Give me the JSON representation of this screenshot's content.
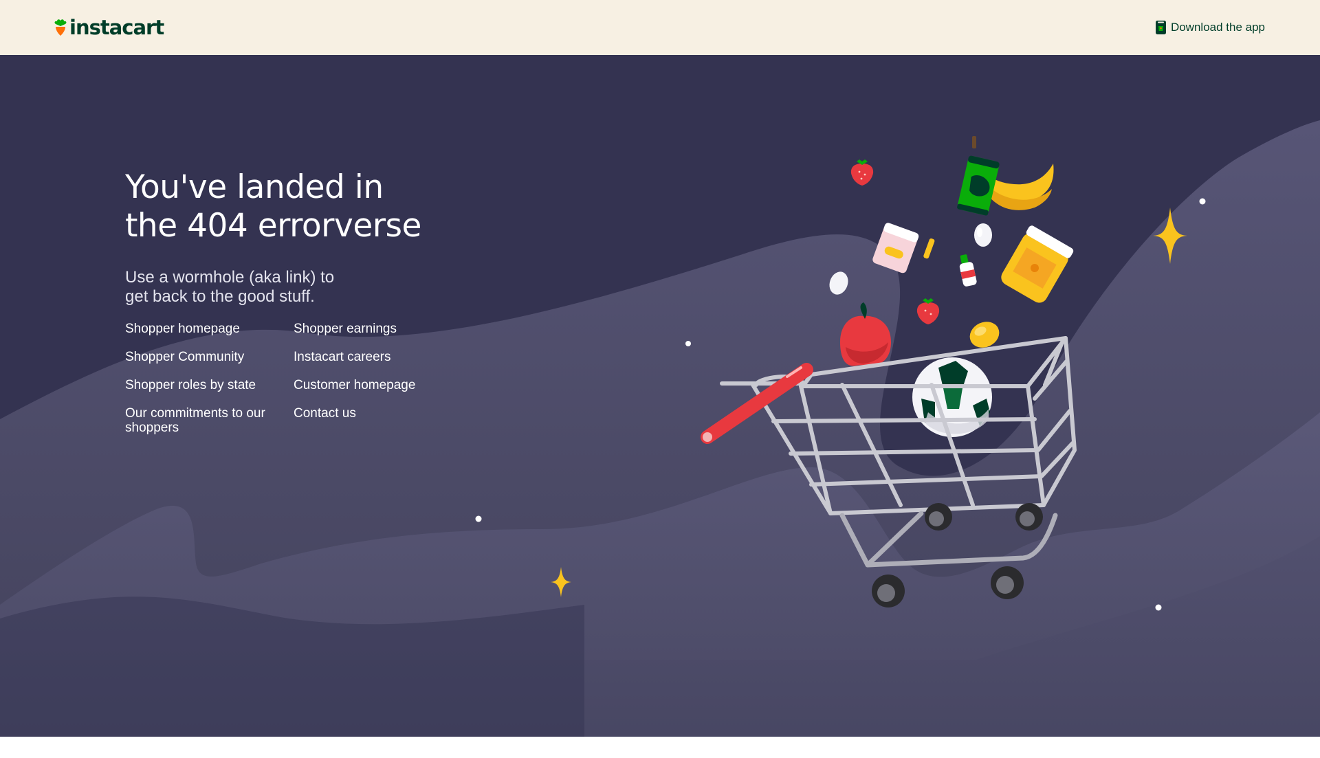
{
  "header": {
    "logo_text": "instacart",
    "download_label": "Download the app"
  },
  "hero": {
    "headline_line1": "You've landed in",
    "headline_line2": "the 404 errorverse",
    "subtitle_line1": "Use a wormhole (aka link) to",
    "subtitle_line2": "get back to the good stuff.",
    "links": [
      "Shopper homepage",
      "Shopper earnings",
      "Shopper Community",
      "Instacart careers",
      "Shopper roles by state",
      "Customer homepage",
      "Our commitments to our shoppers",
      "Contact us"
    ]
  },
  "colors": {
    "header_bg": "#f7f0e3",
    "hero_bg": "#343351",
    "brand_green": "#003d29",
    "carrot_orange": "#ff7009",
    "leaf_green": "#0aad0a",
    "star_yellow": "#fac31e"
  },
  "icons": [
    "carrot-logo-icon",
    "phone-bag-icon"
  ]
}
